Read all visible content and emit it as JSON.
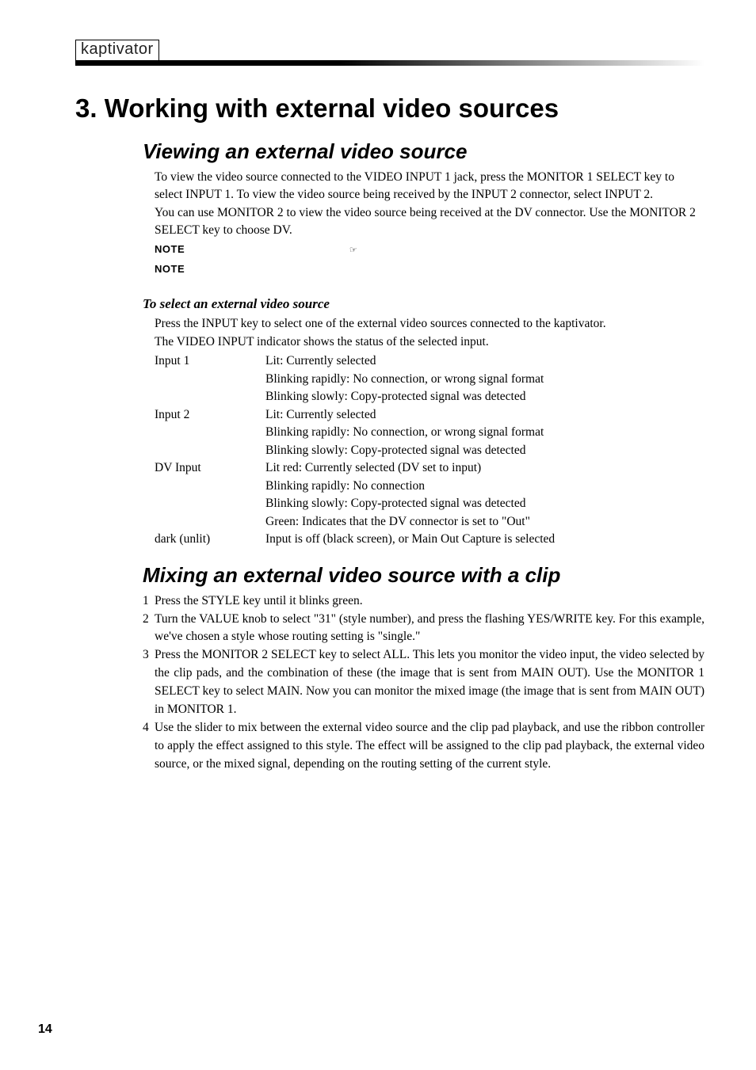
{
  "header": {
    "logo": "kaptivator"
  },
  "section": {
    "title": "3.  Working with external video sources"
  },
  "viewing": {
    "heading": "Viewing an external video source",
    "p1": "To view the video source connected to the VIDEO INPUT 1 jack, press the MONITOR 1 SELECT key to select INPUT 1. To view the video source being received by the INPUT 2 connector, select INPUT 2.",
    "p2": "You can use MONITOR 2 to view the video source being received at the DV connector. Use the MONITOR 2 SELECT key to choose DV.",
    "note1_label": "NOTE",
    "note1_pointer": "☞",
    "note2_label": "NOTE"
  },
  "select": {
    "heading": "To select an external video source",
    "p1": "Press the INPUT key to select one of the external video sources connected to the kaptivator.",
    "p2": "The VIDEO INPUT indicator shows the status of the selected input.",
    "rows": [
      {
        "label": "Input 1",
        "value": "Lit: Currently selected"
      },
      {
        "label": "",
        "value": "Blinking rapidly: No connection, or wrong signal format"
      },
      {
        "label": "",
        "value": "Blinking slowly: Copy-protected signal was detected"
      },
      {
        "label": "Input 2",
        "value": "Lit: Currently selected"
      },
      {
        "label": "",
        "value": "Blinking rapidly: No connection, or wrong signal format"
      },
      {
        "label": "",
        "value": "Blinking slowly: Copy-protected signal was detected"
      },
      {
        "label": "DV Input",
        "value": "Lit red: Currently selected (DV set to input)"
      },
      {
        "label": "",
        "value": "Blinking rapidly: No connection"
      },
      {
        "label": "",
        "value": "Blinking slowly: Copy-protected signal was detected"
      },
      {
        "label": "",
        "value": "Green: Indicates that the DV connector is set to \"Out\""
      },
      {
        "label": "dark (unlit)",
        "value": "Input is off (black screen), or Main Out Capture is selected"
      }
    ]
  },
  "mixing": {
    "heading": "Mixing an external video source with a clip",
    "items": [
      "Press the STYLE key until it blinks green.",
      "Turn the VALUE knob to select \"31\" (style number), and press the flashing YES/WRITE key. For this example, we've chosen a style whose routing setting is \"single.\"",
      "Press the MONITOR 2 SELECT key to select ALL. This lets you monitor the video input, the video selected by the clip pads, and the combination of these (the image that is sent from MAIN OUT). Use the MONITOR 1 SELECT key to select MAIN. Now you can monitor the mixed image (the image that is sent from MAIN OUT) in MONITOR 1.",
      "Use the slider to mix between the external video source and the clip pad playback, and use the ribbon controller to apply the effect assigned to this style. The effect will be assigned to the clip pad playback, the external video source, or the mixed signal, depending on the routing setting of the current style."
    ]
  },
  "page_number": "14"
}
